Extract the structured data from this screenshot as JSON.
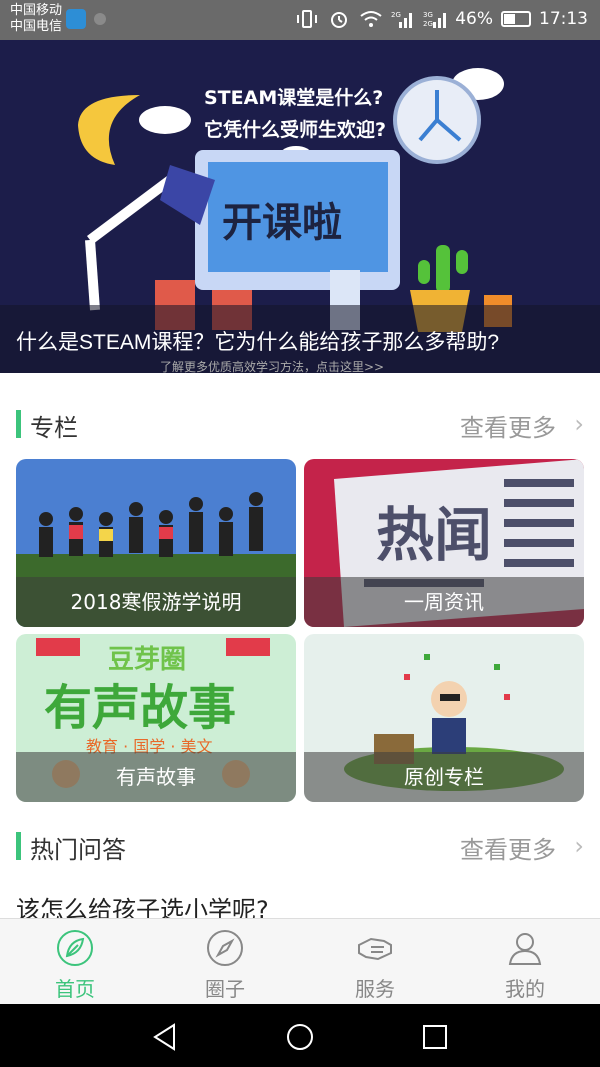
{
  "status_bar": {
    "carrier_1": "中国移动",
    "carrier_2": "中国电信",
    "battery": "46%",
    "time": "17:13",
    "net_1": "2G",
    "net_2": "3G",
    "net_3": "2G"
  },
  "banner": {
    "art_line_1": "STEAM课堂是什么?",
    "art_line_2": "它凭什么受师生欢迎?",
    "art_screen": "开课啦",
    "title": "什么是STEAM课程？它为什么能给孩子那么多帮助?",
    "subtitle": "了解更多优质高效学习方法，点击这里>>"
  },
  "column_section": {
    "title": "专栏",
    "see_more": "查看更多",
    "cards": [
      {
        "label": "2018寒假游学说明",
        "image": "group-photo"
      },
      {
        "label": "一周资讯",
        "image": "newspaper-hot-news",
        "art_text": "热闻"
      },
      {
        "label": "有声故事",
        "image": "audio-story-poster",
        "art_text": "有声故事",
        "art_top": "豆芽圈",
        "art_sub": "教育 · 国学 · 美文"
      },
      {
        "label": "原创专栏",
        "image": "kid-with-books"
      }
    ]
  },
  "qa_section": {
    "title": "热门问答",
    "see_more": "查看更多",
    "first_question": "该怎么给孩子选小学呢?"
  },
  "tabs": [
    {
      "label": "首页",
      "icon": "leaf-icon",
      "active": true
    },
    {
      "label": "圈子",
      "icon": "compass-icon",
      "active": false
    },
    {
      "label": "服务",
      "icon": "handshake-icon",
      "active": false
    },
    {
      "label": "我的",
      "icon": "user-icon",
      "active": false
    }
  ],
  "colors": {
    "accent": "#3cc47c",
    "banner_bg": "#1c1d4a",
    "status_bar": "#6a6a6a"
  }
}
